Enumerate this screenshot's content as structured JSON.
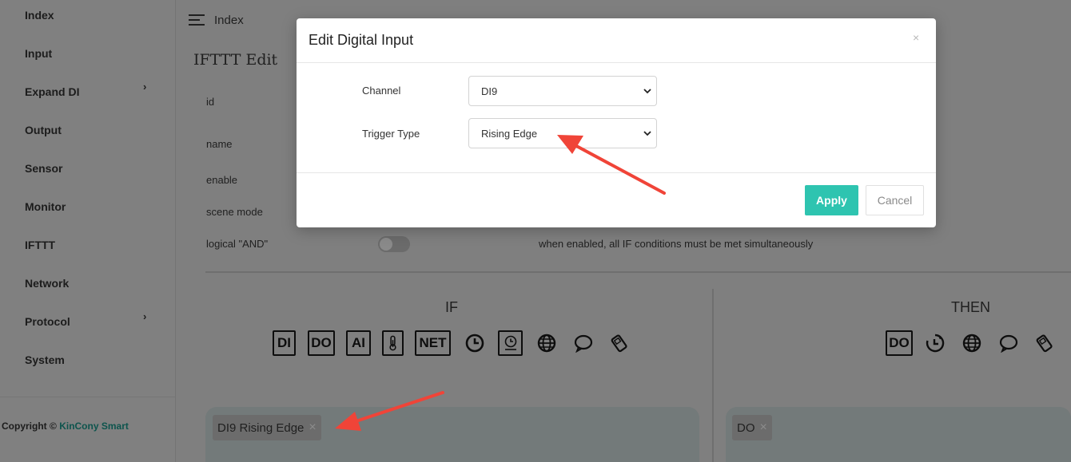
{
  "sidebar": {
    "items": [
      {
        "label": "Index"
      },
      {
        "label": "Input"
      },
      {
        "label": "Expand DI",
        "chevron": "›"
      },
      {
        "label": "Output"
      },
      {
        "label": "Sensor"
      },
      {
        "label": "Monitor"
      },
      {
        "label": "IFTTT"
      },
      {
        "label": "Network"
      },
      {
        "label": "Protocol",
        "chevron": "›"
      },
      {
        "label": "System"
      }
    ],
    "copyright_prefix": "Copyright ©",
    "copyright_brand": "KinCony Smart"
  },
  "header": {
    "menu_icon": "hamburger-menu-icon",
    "title": "Index"
  },
  "page": {
    "title": "IFTTT Edit",
    "fields": [
      "id",
      "name",
      "enable",
      "scene mode",
      "logical \"AND\""
    ],
    "and_toggle_on": false,
    "and_hint": "when enabled, all IF conditions must be met simultaneously"
  },
  "if_section": {
    "heading": "IF",
    "icons": [
      {
        "icon": "di-icon",
        "label": "DI"
      },
      {
        "icon": "do-icon",
        "label": "DO"
      },
      {
        "icon": "ai-icon",
        "label": "AI"
      },
      {
        "icon": "thermometer-icon"
      },
      {
        "icon": "net-icon",
        "label": "NET"
      },
      {
        "icon": "clock-icon"
      },
      {
        "icon": "alarm-clock-icon"
      },
      {
        "icon": "globe-icon"
      },
      {
        "icon": "sms-icon",
        "label": "SMS"
      },
      {
        "icon": "phone-icon"
      }
    ],
    "tag_label": "DI9 Rising Edge",
    "tag_close": "×"
  },
  "then_section": {
    "heading": "THEN",
    "icons": [
      {
        "icon": "do-icon",
        "label": "DO"
      },
      {
        "icon": "timer-icon"
      },
      {
        "icon": "globe-icon"
      },
      {
        "icon": "sms-icon",
        "label": "SMS"
      },
      {
        "icon": "phone-icon"
      }
    ],
    "tag_label": "DO",
    "tag_close": "×"
  },
  "modal": {
    "title": "Edit Digital Input",
    "close": "×",
    "channel_label": "Channel",
    "channel_value": "DI9",
    "trigger_label": "Trigger Type",
    "trigger_value": "Rising Edge",
    "apply_label": "Apply",
    "cancel_label": "Cancel"
  },
  "colors": {
    "accent": "#2ec4b0",
    "brand_text": "#0d544d",
    "annotation_arrow": "#f04438",
    "overlay": "#7f7f7f"
  }
}
